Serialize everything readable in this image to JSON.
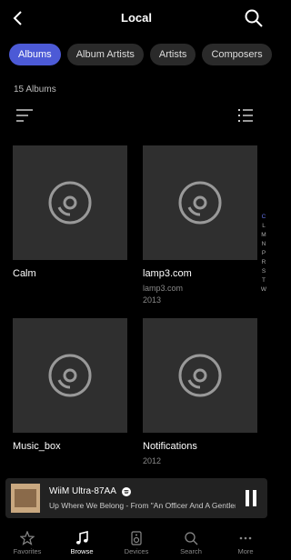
{
  "header": {
    "title": "Local"
  },
  "filters": [
    {
      "label": "Albums",
      "active": true
    },
    {
      "label": "Album Artists",
      "active": false
    },
    {
      "label": "Artists",
      "active": false
    },
    {
      "label": "Composers",
      "active": false
    }
  ],
  "count_text": "15 Albums",
  "albums": [
    {
      "title": "Calm",
      "artist": "",
      "year": ""
    },
    {
      "title": "lamp3.com",
      "artist": "lamp3.com",
      "year": "2013"
    },
    {
      "title": "Music_box",
      "artist": "",
      "year": ""
    },
    {
      "title": "Notifications",
      "artist": "",
      "year": "2012"
    }
  ],
  "az_index": [
    "C",
    "L",
    "M",
    "N",
    "P",
    "R",
    "S",
    "T",
    "W"
  ],
  "az_highlight": "C",
  "player": {
    "device": "WiiM Ultra-87AA",
    "track": "Up Where We Belong - From \"An Officer And A Gentleman\"",
    "state": "playing"
  },
  "tabs": [
    {
      "label": "Favorites",
      "icon": "star-icon",
      "active": false
    },
    {
      "label": "Browse",
      "icon": "music-note-icon",
      "active": true
    },
    {
      "label": "Devices",
      "icon": "speaker-icon",
      "active": false
    },
    {
      "label": "Search",
      "icon": "search-icon",
      "active": false
    },
    {
      "label": "More",
      "icon": "more-icon",
      "active": false
    }
  ]
}
